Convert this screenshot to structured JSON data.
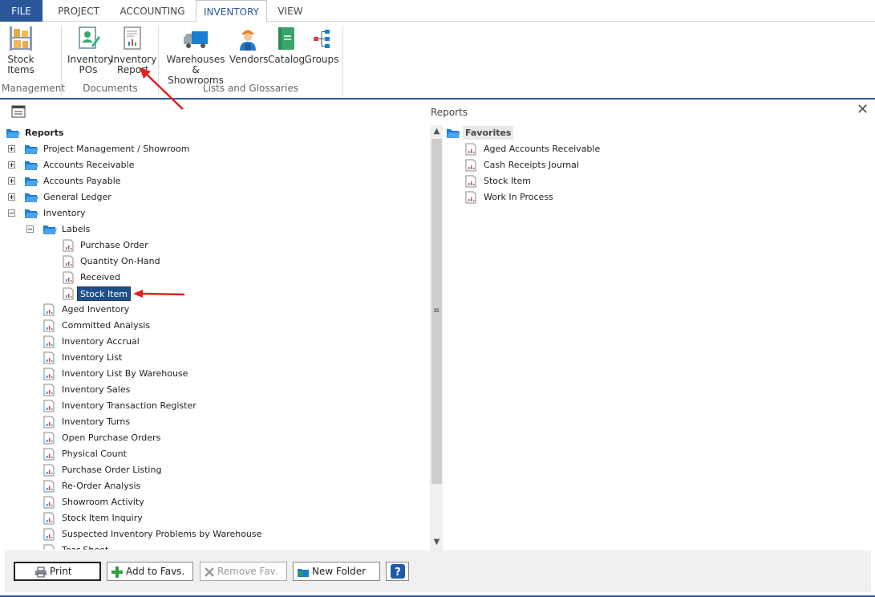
{
  "menu": {
    "tabs": [
      "FILE",
      "PROJECT",
      "ACCOUNTING",
      "INVENTORY",
      "VIEW"
    ],
    "active": "INVENTORY"
  },
  "ribbon": {
    "buttons": {
      "stock_items": {
        "line1": "Stock",
        "line2": "Items"
      },
      "inventory_pos": {
        "line1": "Inventory",
        "line2": "POs"
      },
      "inventory_reports": {
        "line1": "Inventory",
        "line2": "Reports"
      },
      "warehouses": {
        "line1": "Warehouses",
        "line2": "& Showrooms"
      },
      "vendors": {
        "line1": "Vendors"
      },
      "catalog": {
        "line1": "Catalog"
      },
      "groups": {
        "line1": "Groups"
      }
    },
    "groups": {
      "management": "Management",
      "documents": "Documents",
      "lists": "Lists and Glossaries"
    }
  },
  "tree": {
    "root": "Reports",
    "folders": [
      "Project Management / Showroom",
      "Accounts Receivable",
      "Accounts Payable",
      "General Ledger",
      "Inventory"
    ],
    "labels_folder": "Labels",
    "labels_items": [
      "Purchase Order",
      "Quantity On-Hand",
      "Received",
      "Stock Item"
    ],
    "selected": "Stock Item",
    "inventory_reports": [
      "Aged Inventory",
      "Committed Analysis",
      "Inventory Accrual",
      "Inventory List",
      "Inventory List By Warehouse",
      "Inventory Sales",
      "Inventory Transaction Register",
      "Inventory Turns",
      "Open Purchase Orders",
      "Physical Count",
      "Purchase Order Listing",
      "Re-Order Analysis",
      "Showroom Activity",
      "Stock Item Inquiry",
      "Suspected Inventory Problems by Warehouse",
      "Tear Sheet"
    ]
  },
  "right_panel": {
    "title": "Reports",
    "close": "✕",
    "favorites_label": "Favorites",
    "favorites": [
      "Aged Accounts Receivable",
      "Cash Receipts Journal",
      "Stock Item",
      "Work In Process"
    ]
  },
  "buttons": {
    "print": "Print",
    "add_fav": "Add to Favs.",
    "remove_fav": "Remove Fav.",
    "new_folder": "New Folder"
  },
  "colors": {
    "accent": "#2b579a",
    "folder": "#1a7fd4",
    "selection": "#1e4f8c",
    "arrow": "#e02020"
  }
}
